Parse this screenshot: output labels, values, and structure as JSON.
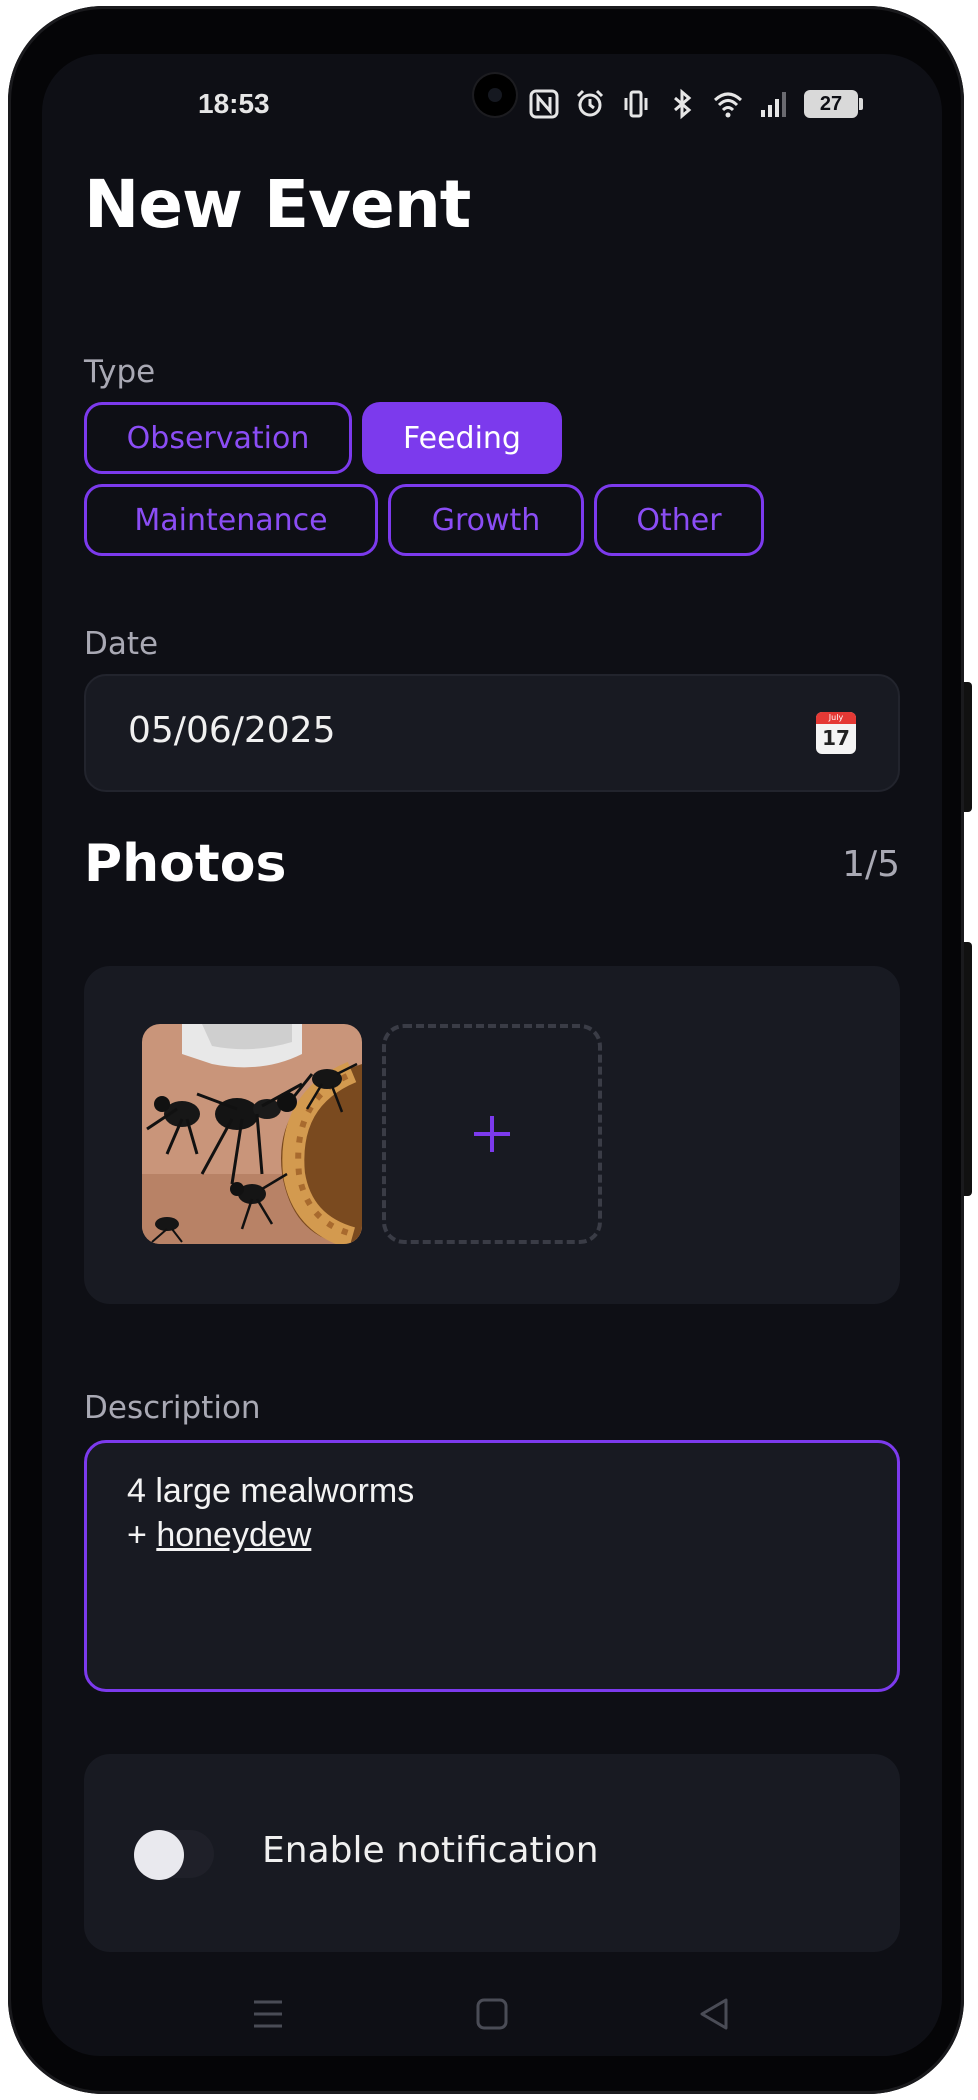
{
  "status_bar": {
    "time": "18:53",
    "battery": "27",
    "icons": [
      "nfc-icon",
      "alarm-icon",
      "vibrate-icon",
      "bluetooth-icon",
      "wifi-icon",
      "signal-icon",
      "battery-icon"
    ]
  },
  "page": {
    "title": "New Event"
  },
  "type": {
    "label": "Type",
    "options": [
      "Observation",
      "Feeding",
      "Maintenance",
      "Growth",
      "Other"
    ],
    "selected": "Feeding"
  },
  "date": {
    "label": "Date",
    "value": "05/06/2025",
    "calendar_month": "July",
    "calendar_day": "17"
  },
  "photos": {
    "title": "Photos",
    "count": "1/5",
    "add_symbol": "+"
  },
  "description": {
    "label": "Description",
    "line1": "4 large mealworms",
    "line2_prefix": "+ ",
    "line2_word": "honeydew"
  },
  "notification": {
    "label": "Enable notification",
    "enabled": false
  },
  "nav": {
    "buttons": [
      "menu-icon",
      "home-icon",
      "back-icon"
    ]
  },
  "colors": {
    "accent": "#7c3aed",
    "background": "#0e0f15",
    "surface": "#181a22"
  }
}
